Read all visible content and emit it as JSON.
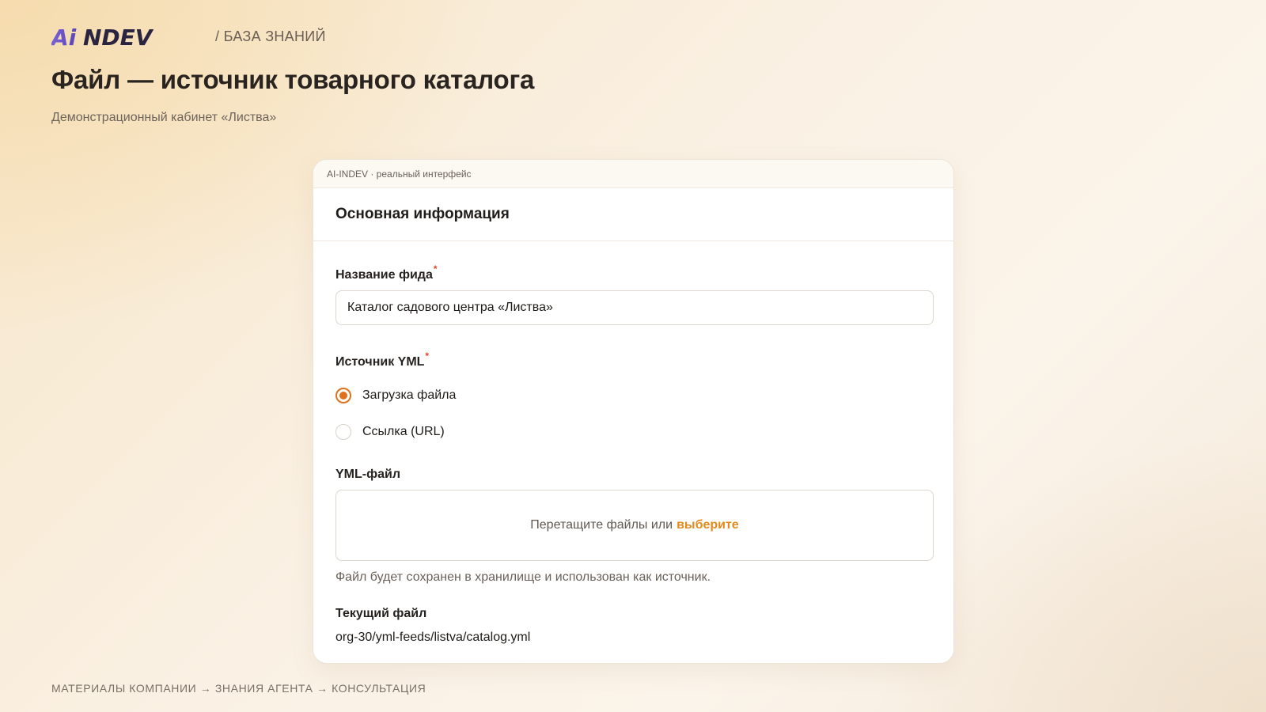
{
  "header": {
    "logo_text": "AiNDEV",
    "breadcrumb": "/ БАЗА ЗНАНИЙ"
  },
  "page": {
    "title": "Файл — источник товарного каталога",
    "subtitle": "Демонстрационный кабинет «Листва»"
  },
  "window": {
    "bar_text": "AI-INDEV · реальный интерфейс",
    "section_title": "Основная информация",
    "feed_name": {
      "label": "Название фида",
      "required_mark": "*",
      "value": "Каталог садового центра «Листва»"
    },
    "yml_source": {
      "label": "Источник YML",
      "required_mark": "*",
      "options": [
        {
          "label": "Загрузка файла",
          "selected": true
        },
        {
          "label": "Ссылка (URL)",
          "selected": false
        }
      ]
    },
    "yml_file": {
      "label": "YML-файл",
      "drop_text": "Перетащите файлы или",
      "drop_link": "выберите",
      "hint": "Файл будет сохранен в хранилище и использован как источник."
    },
    "current_file": {
      "label": "Текущий файл",
      "value": "org-30/yml-feeds/listva/catalog.yml"
    }
  },
  "footer": {
    "nav": "МАТЕРИАЛЫ КОМПАНИИ → ЗНАНИЯ АГЕНТА → КОНСУЛЬТАЦИЯ"
  },
  "colors": {
    "accent": "#e0711a",
    "link": "#e38a1d",
    "logo_purple": "#6b52c7",
    "logo_dark": "#2a2440",
    "required": "#e0452b"
  }
}
